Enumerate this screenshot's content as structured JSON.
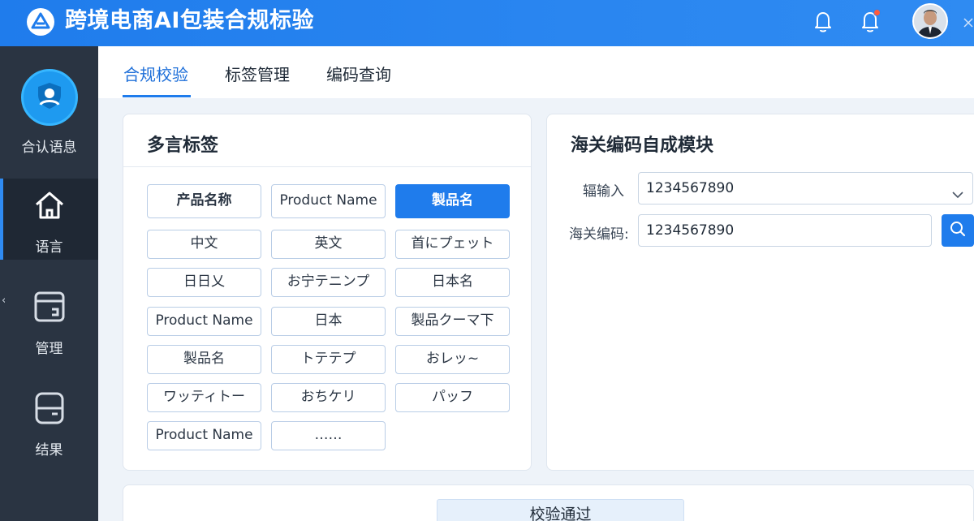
{
  "app": {
    "title": "跨境电商AI包装合规标验"
  },
  "sidebar": {
    "profile_label": "合认语息",
    "items": [
      {
        "label": "语言",
        "icon": "home-icon",
        "active": true
      },
      {
        "label": "管理",
        "icon": "manage-icon",
        "active": false
      },
      {
        "label": "结果",
        "icon": "result-icon",
        "active": false
      }
    ]
  },
  "tabs": [
    {
      "label": "合规校验",
      "active": true
    },
    {
      "label": "标签管理",
      "active": false
    },
    {
      "label": "编码查询",
      "active": false
    }
  ],
  "labels_panel": {
    "title": "多言标签",
    "chips": [
      [
        "产品名称",
        "Product Name",
        "製品名"
      ],
      [
        "中文",
        "英文",
        "首にプェット"
      ],
      [
        "日日乂",
        "お宁テニンプ",
        "日本名"
      ],
      [
        "Product Name",
        "日本",
        "製品クーマ下"
      ],
      [
        "製品名",
        "トテテプ",
        "おレッ~"
      ],
      [
        "ワッティトー",
        "おちケリ",
        "パッフ"
      ],
      [
        "Product Name",
        "……"
      ]
    ]
  },
  "hs_panel": {
    "title": "海关编码自成模块",
    "input_label": "辐输入",
    "input_value": "1234567890",
    "code_label": "海关编码:",
    "code_value": "1234567890"
  },
  "result": {
    "badge": "校验通过"
  },
  "colors": {
    "primary": "#1f7cec",
    "sidebar": "#2a3442",
    "alert_dot": "#ff5a3c"
  }
}
